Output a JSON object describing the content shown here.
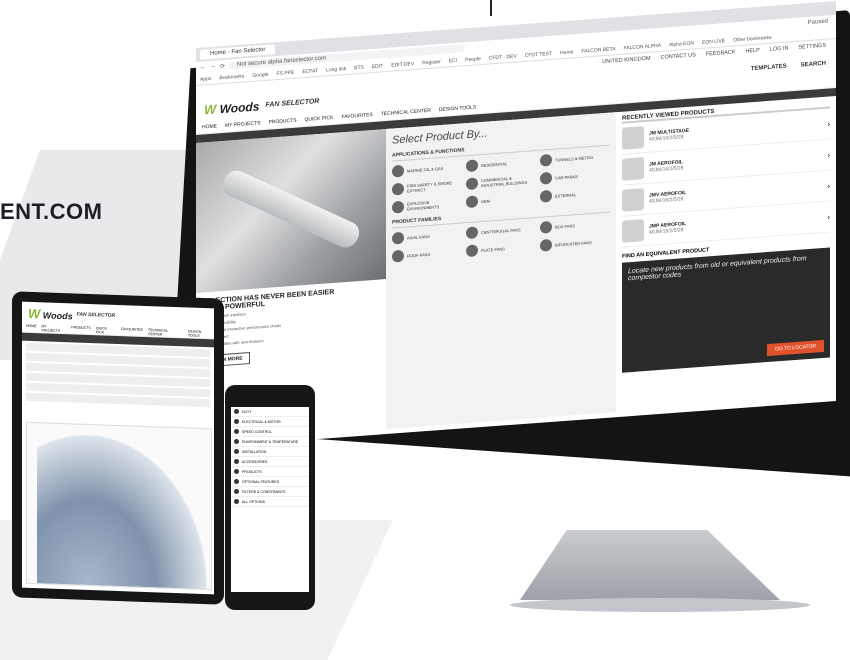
{
  "hero": {
    "partial_url_text": "ENT.COM"
  },
  "browser": {
    "tab_title": "Home - Fan Selector",
    "url": "Not secure   alpha.fanselector.com",
    "bookmarks": [
      "Apps",
      "Bookmarks",
      "Google",
      "FS PPE",
      "ECFAT",
      "Long link",
      "BTS",
      "EDIT",
      "EDIT DEV",
      "Register",
      "ECI",
      "People",
      "CFDT - DEV",
      "CFDT TEST",
      "Home",
      "FALCON BETA",
      "FALCON ALPHA",
      "Alpha EON",
      "EON LIVE",
      "Other bookmarks"
    ],
    "profile": "Paused"
  },
  "site": {
    "utility": [
      "UNITED KINGDOM",
      "CONTACT US",
      "FEEDBACK",
      "HELP",
      "LOG IN",
      "SETTINGS"
    ],
    "logo": "Woods",
    "logo_sub": "FAN SELECTOR",
    "templates": "TEMPLATES",
    "search": "SEARCH",
    "nav": [
      "HOME",
      "MY PROJECTS",
      "PRODUCTS",
      "QUICK PICK",
      "FAVOURITES",
      "TECHNICAL CENTER",
      "DESIGN TOOLS"
    ]
  },
  "hero_panel": {
    "title": "SELECTION HAS NEVER BEEN EASIER",
    "title2": "MORE POWERFUL",
    "bullets": [
      "improved touch interface",
      "atform accessibility",
      "st visuals and interactive performance charts",
      "ully web based",
      "monthly updates with new features"
    ],
    "learn_more": "LEARN MORE"
  },
  "select": {
    "title": "Select Product By...",
    "apps_title": "APPLICATIONS & FUNCTIONS",
    "apps": [
      "MARINE OIL & GAS",
      "RESIDENTIAL",
      "TUNNELS & METRO",
      "FIRE SAFETY & SMOKE EXTRACT",
      "COMMERCIAL & INDUSTRIAL BUILDINGS",
      "CAR PARKS",
      "EXPLOSIVE ENVIRONMENTS",
      "OEM",
      "EXTERNAL"
    ],
    "families_title": "PRODUCT FAMILIES",
    "families": [
      "AXIAL FANS",
      "CENTRIFUGAL FANS",
      "BOX FANS",
      "ROOF FANS",
      "PLATE FANS",
      "BIFURCATED FANS"
    ]
  },
  "recent": {
    "title": "RECENTLY VIEWED PRODUCTS",
    "items": [
      {
        "name": "JM MULTISTAGE",
        "code": "40JM/16/2/5/28"
      },
      {
        "name": "JM AEROFOIL",
        "code": "40JM/16/2/5/28"
      },
      {
        "name": "JMV AEROFOIL",
        "code": "40JM/16/2/5/28"
      },
      {
        "name": "JMP AEROFOIL",
        "code": "40JM/16/2/5/28"
      }
    ]
  },
  "equivalent": {
    "title": "FIND AN EQUIVALENT PRODUCT",
    "text": "Locate new products from old or equivalent products from competitor codes",
    "button": "GO TO LOCATOR"
  },
  "tablet": {
    "logo": "Woods",
    "logo_sub": "FAN SELECTOR",
    "nav": [
      "HOME",
      "MY PROJECTS",
      "PRODUCTS",
      "QUICK PICK",
      "FAVOURITES",
      "TECHNICAL CENTER",
      "DESIGN TOOLS"
    ]
  },
  "phone": {
    "sections": [
      "DUTY",
      "ELECTRICAL & MOTOR",
      "SPEED CONTROL",
      "ENVIRONMENT & TEMPERATURE",
      "INSTALLATION",
      "ACCESSORIES",
      "PRODUCTS",
      "OPTIONAL FEATURES",
      "FILTERS & CONSTRAINTS",
      "ALL OPTIONS"
    ]
  }
}
